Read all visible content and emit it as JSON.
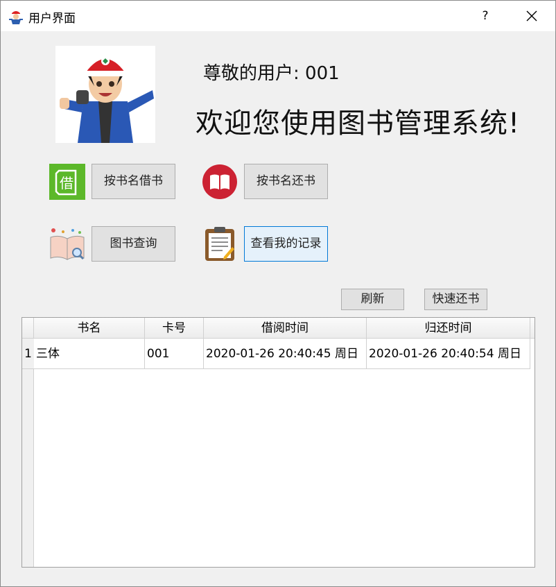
{
  "window": {
    "title": "用户界面",
    "help_label": "?",
    "close_icon": "close-icon"
  },
  "header": {
    "greeting": "尊敬的用户: 001",
    "welcome": "欢迎您使用图书管理系统!"
  },
  "actions": {
    "borrow_by_name": "按书名借书",
    "borrow_icon_char": "借",
    "return_by_name": "按书名还书",
    "search_books": "图书查询",
    "my_records": "查看我的记录"
  },
  "toolbar": {
    "refresh": "刷新",
    "quick_return": "快速还书"
  },
  "table": {
    "columns": [
      "书名",
      "卡号",
      "借阅时间",
      "归还时间"
    ],
    "rows": [
      {
        "index": "1",
        "cells": [
          "三体",
          "001",
          "2020-01-26 20:40:45 周日",
          "2020-01-26 20:40:54 周日"
        ]
      }
    ]
  },
  "colors": {
    "accent": "#0078d7",
    "borrow_icon_green": "#5cb82a",
    "return_icon_red": "#cc2233"
  }
}
